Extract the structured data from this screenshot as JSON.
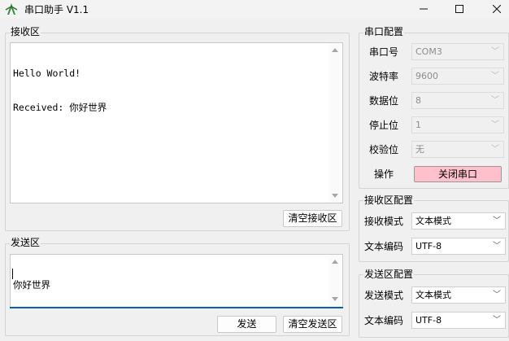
{
  "window": {
    "title": "串口助手 V1.1"
  },
  "receive_area": {
    "group_title": "接收区",
    "lines": [
      "Hello World!",
      "Received: 你好世界"
    ],
    "clear_button": "清空接收区"
  },
  "send_area": {
    "group_title": "发送区",
    "text": "你好世界",
    "send_button": "发送",
    "clear_button": "清空发送区"
  },
  "serial_config": {
    "group_title": "串口配置",
    "port_label": "串口号",
    "port_value": "COM3",
    "baud_label": "波特率",
    "baud_value": "9600",
    "databits_label": "数据位",
    "databits_value": "8",
    "stopbits_label": "停止位",
    "stopbits_value": "1",
    "parity_label": "校验位",
    "parity_value": "无",
    "action_label": "操作",
    "action_button": "关闭串口",
    "action_button_color": "#ffc0cb"
  },
  "receive_config": {
    "group_title": "接收区配置",
    "mode_label": "接收模式",
    "mode_value": "文本模式",
    "encoding_label": "文本编码",
    "encoding_value": "UTF-8"
  },
  "send_config": {
    "group_title": "发送区配置",
    "mode_label": "发送模式",
    "mode_value": "文本模式",
    "encoding_label": "文本编码",
    "encoding_value": "UTF-8"
  },
  "icons": {
    "app": "app-logo-icon",
    "minimize": "minimize-icon",
    "maximize": "maximize-icon",
    "close": "close-icon"
  },
  "colors": {
    "accent": "#0b5ea8"
  }
}
